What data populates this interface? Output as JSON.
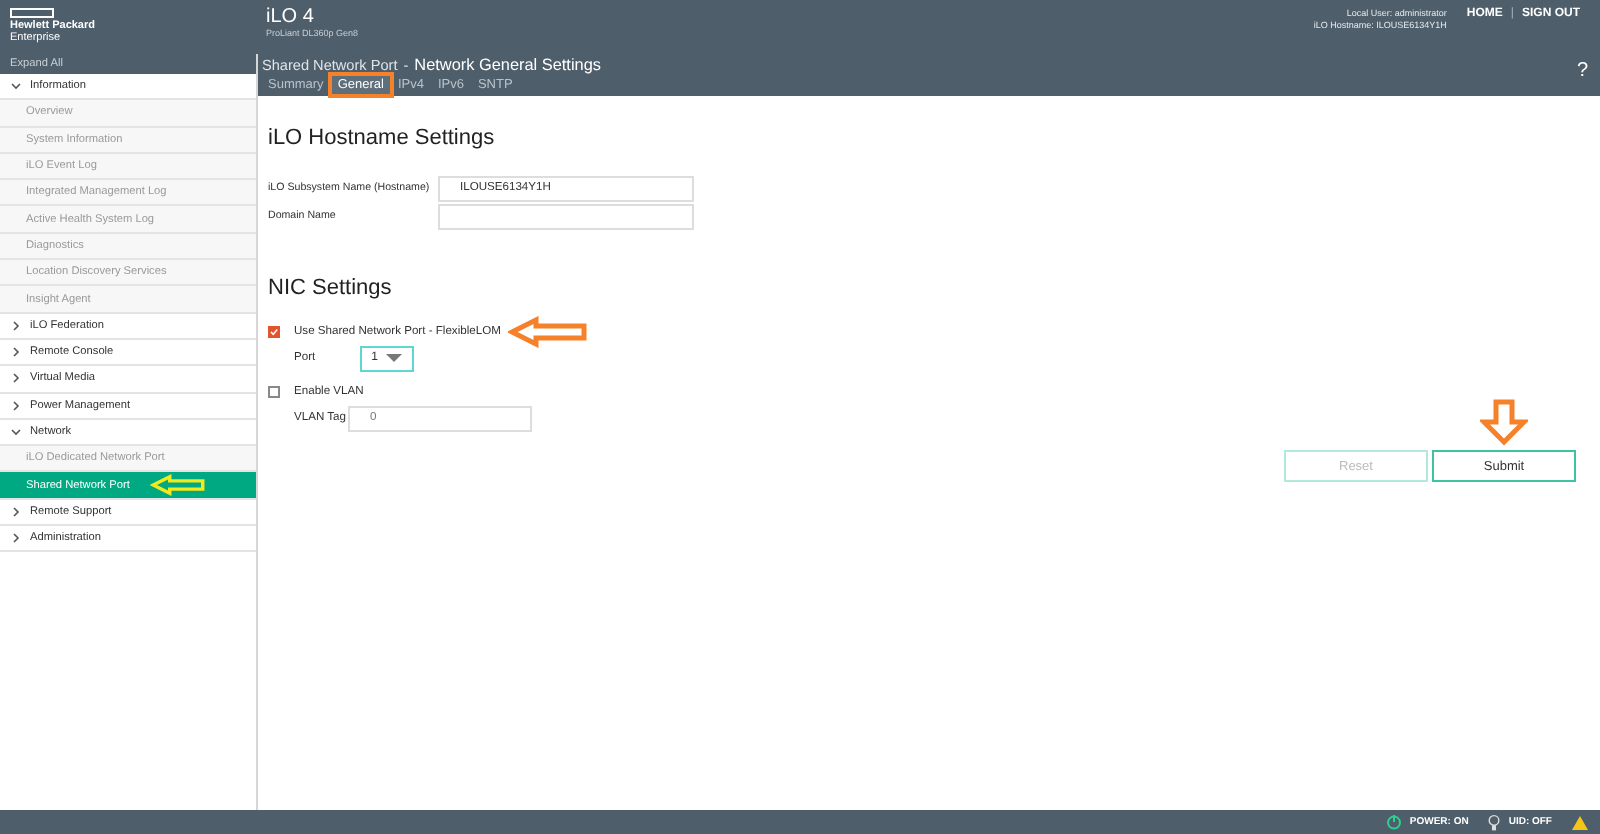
{
  "header": {
    "brand_line_1": "Hewlett Packard",
    "brand_line_2": "Enterprise",
    "product": "iLO 4",
    "model": "ProLiant DL360p Gen8",
    "user": "Local User: administrator",
    "hostname": "iLO Hostname: ILOUSE6134Y1H",
    "links": [
      "HOME",
      "SIGN OUT"
    ],
    "separator": "|",
    "help": "?"
  },
  "sidebar": {
    "expand_all": "Expand All",
    "items": [
      {
        "label": "Information",
        "expanded": true,
        "children": [
          {
            "label": "Overview",
            "selected": false
          },
          {
            "label": "System Information",
            "selected": false
          },
          {
            "label": "iLO Event Log",
            "selected": false
          },
          {
            "label": "Integrated Management Log",
            "selected": false
          },
          {
            "label": "Active Health System Log",
            "selected": false
          },
          {
            "label": "Diagnostics",
            "selected": false
          },
          {
            "label": "Location Discovery Services",
            "selected": false
          },
          {
            "label": "Insight Agent",
            "selected": false
          }
        ]
      },
      {
        "label": "iLO Federation",
        "expanded": false
      },
      {
        "label": "Remote Console",
        "expanded": false
      },
      {
        "label": "Virtual Media",
        "expanded": false
      },
      {
        "label": "Power Management",
        "expanded": false
      },
      {
        "label": "Network",
        "expanded": true,
        "children": [
          {
            "label": "iLO Dedicated Network Port",
            "selected": false
          },
          {
            "label": "Shared Network Port",
            "selected": true,
            "marker": {
              "kind": "arrow-left",
              "color": "#f2ea1c"
            }
          }
        ]
      },
      {
        "label": "Remote Support",
        "expanded": false
      },
      {
        "label": "Administration",
        "expanded": false
      }
    ]
  },
  "page": {
    "title_prefix": "Shared Network Port",
    "title_separator": "-",
    "title": "Network General Settings",
    "tabs": [
      {
        "label": "Summary",
        "selected": false,
        "highlighted": false
      },
      {
        "label": "General",
        "selected": true,
        "highlighted": true
      },
      {
        "label": "IPv4",
        "selected": false,
        "highlighted": false
      },
      {
        "label": "IPv6",
        "selected": false,
        "highlighted": false
      },
      {
        "label": "SNTP",
        "selected": false,
        "highlighted": false
      }
    ]
  },
  "hostname_settings": {
    "heading": "iLO Hostname Settings",
    "fields": [
      {
        "label": "iLO Subsystem Name (Hostname)",
        "value": "ILOUSE6134Y1H"
      },
      {
        "label": "Domain Name"
      }
    ]
  },
  "nic_settings": {
    "heading": "NIC Settings",
    "shared_port": {
      "label": "Use Shared Network Port - FlexibleLOM",
      "checked": true,
      "marker": {
        "kind": "arrow-left",
        "color": "#f5822a"
      }
    },
    "port": {
      "label": "Port",
      "value": "1"
    },
    "vlan": {
      "label": "Enable VLAN",
      "checked": false
    },
    "vlan_tag": {
      "label": "VLAN Tag",
      "placeholder": "0"
    }
  },
  "buttons": [
    {
      "label": "Reset",
      "disabled": true
    },
    {
      "label": "Submit",
      "disabled": false,
      "marker": {
        "kind": "arrow-down",
        "color": "#f5822a"
      }
    }
  ],
  "footer": {
    "power": "POWER: ON",
    "uid": "UID: OFF"
  }
}
